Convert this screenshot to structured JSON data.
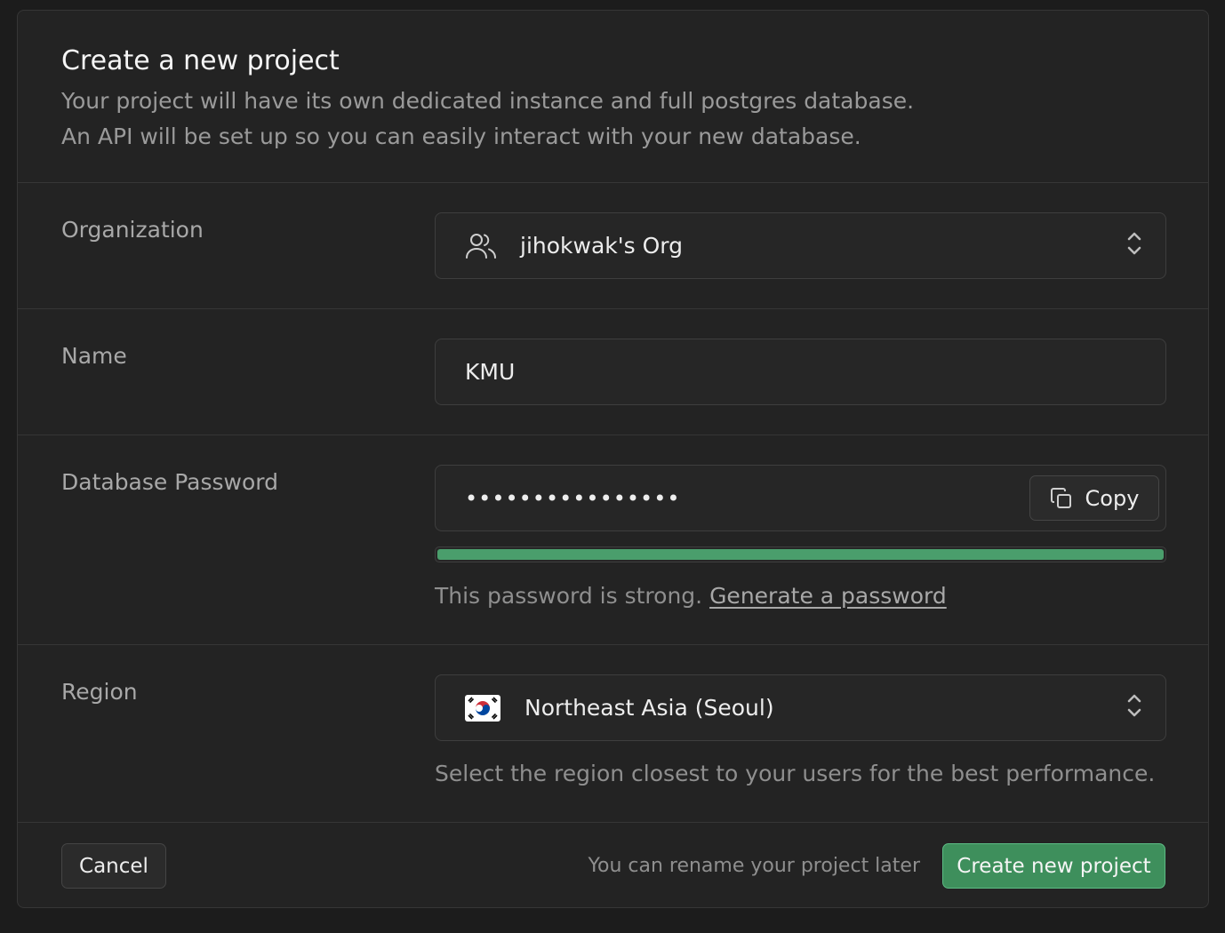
{
  "header": {
    "title": "Create a new project",
    "subtitle_line1": "Your project will have its own dedicated instance and full postgres database.",
    "subtitle_line2": "An API will be set up so you can easily interact with your new database."
  },
  "organization": {
    "label": "Organization",
    "value": "jihokwak's Org",
    "icon": "users-icon"
  },
  "name": {
    "label": "Name",
    "value": "KMU"
  },
  "password": {
    "label": "Database Password",
    "masked_value": "••••••••••••••••",
    "copy_label": "Copy",
    "strength_fraction": 1.0,
    "strength_color": "#4a9e6c",
    "hint_text": "This password is strong.",
    "generate_link": "Generate a password"
  },
  "region": {
    "label": "Region",
    "value": "Northeast Asia (Seoul)",
    "flag": "south-korea-flag-icon",
    "hint": "Select the region closest to your users for the best performance."
  },
  "footer": {
    "cancel_label": "Cancel",
    "rename_note": "You can rename your project later",
    "create_label": "Create new project"
  },
  "colors": {
    "background": "#1c1c1c",
    "card": "#232323",
    "accent": "#3e8f5c"
  }
}
